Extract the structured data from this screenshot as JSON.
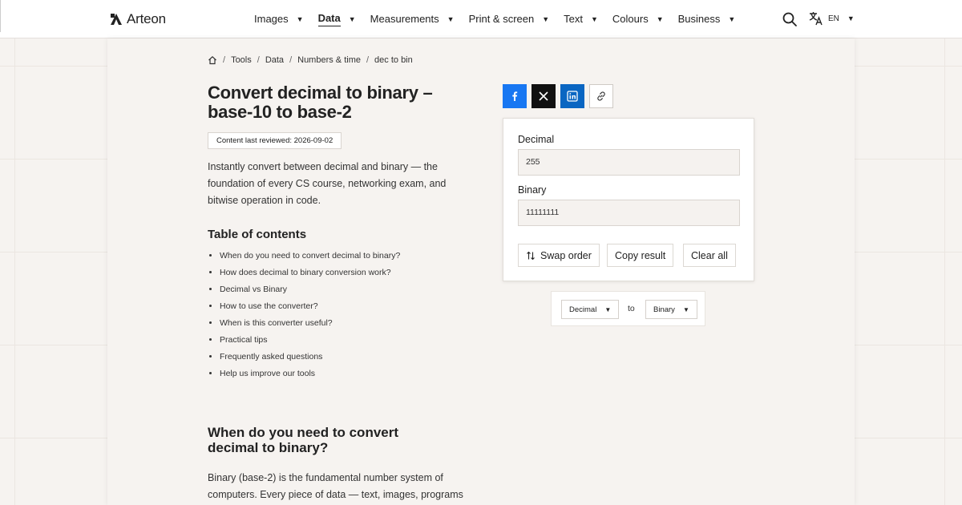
{
  "brand": {
    "name": "Arteon"
  },
  "nav": {
    "items": [
      {
        "label": "Images"
      },
      {
        "label": "Data"
      },
      {
        "label": "Measurements"
      },
      {
        "label": "Print & screen"
      },
      {
        "label": "Text"
      },
      {
        "label": "Colours"
      },
      {
        "label": "Business"
      }
    ],
    "active_index": 1,
    "language": "EN"
  },
  "breadcrumb": [
    "Tools",
    "Data",
    "Numbers & time",
    "dec to bin"
  ],
  "page": {
    "title": "Convert decimal to binary – base-10 to base-2",
    "reviewed": "Content last reviewed: 2026-09-02",
    "intro": "Instantly convert between decimal and binary — the foundation of every CS course, networking exam, and bitwise operation in code.",
    "toc_title": "Table of contents",
    "toc": [
      "When do you need to convert decimal to binary?",
      "How does decimal to binary conversion work?",
      "Decimal vs Binary",
      "How to use the converter?",
      "When is this converter useful?",
      "Practical tips",
      "Frequently asked questions",
      "Help us improve our tools"
    ],
    "section_heading": "When do you need to convert decimal to binary?",
    "section_body": "Binary (base-2) is the fundamental number system of computers. Every piece of data — text, images, programs"
  },
  "converter": {
    "input_label": "Decimal",
    "input_value": "255",
    "output_label": "Binary",
    "output_value": "11111111",
    "swap_label": "Swap order",
    "copy_label": "Copy result",
    "clear_label": "Clear all",
    "from_unit": "Decimal",
    "to_word": "to",
    "to_unit": "Binary"
  },
  "colors": {
    "facebook": "#1877f2",
    "x": "#111111",
    "linkedin": "#0a66c2"
  }
}
